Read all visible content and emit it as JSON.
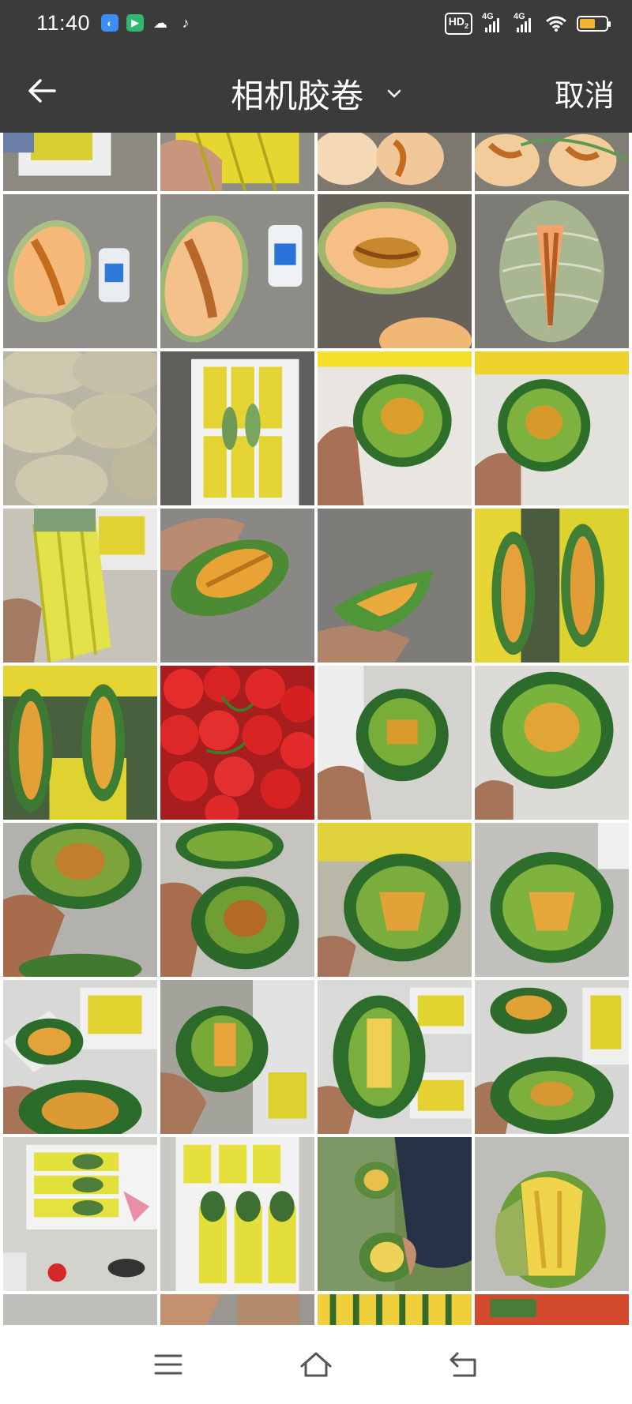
{
  "status_bar": {
    "time": "11:40",
    "hd_label": "HD",
    "hd_sub": "2",
    "net1": "4G",
    "net2": "4G",
    "battery_level": 0.6,
    "battery_color": "#f2b233",
    "app_icons": [
      "chrome-like-icon",
      "play-icon",
      "wechat-icon",
      "tiktok-icon"
    ]
  },
  "title_bar": {
    "title": "相机胶卷",
    "cancel_label": "取消",
    "back_icon": "arrow-left-icon",
    "dropdown_icon": "chevron-down-icon"
  },
  "gallery": {
    "photos": [
      "melon-box-photo",
      "melon-net-photo",
      "melon-halves-photo",
      "melon-halves-photo",
      "melon-slice-refractometer-photo",
      "melon-slice-refractometer-photo",
      "melon-half-photo",
      "melon-cut-photo",
      "melon-stack-photo",
      "melon-box-photo",
      "green-melon-hand-photo",
      "green-melon-hand-photo",
      "melon-net-hand-photo",
      "green-melon-slice-photo",
      "green-melon-slice-photo",
      "melon-net-halves-photo",
      "melon-net-halves-photo",
      "cherry-tomato-photo",
      "green-melon-hand-photo",
      "green-melon-hand-photo",
      "green-melon-hand-photo",
      "green-melon-hand-photo",
      "green-melon-hand-photo",
      "green-melon-hand-photo",
      "melon-box-hand-photo",
      "green-melon-slice-photo",
      "green-melon-slice-photo",
      "green-melon-hand-photo",
      "melon-box-photo",
      "melon-box-photo",
      "melon-field-photo",
      "green-melon-slice-photo",
      "partial-photo",
      "partial-photo",
      "partial-photo",
      "partial-photo"
    ]
  },
  "nav_bar": {
    "menu_icon": "menu-icon",
    "home_icon": "home-icon",
    "back_icon": "back-icon"
  }
}
